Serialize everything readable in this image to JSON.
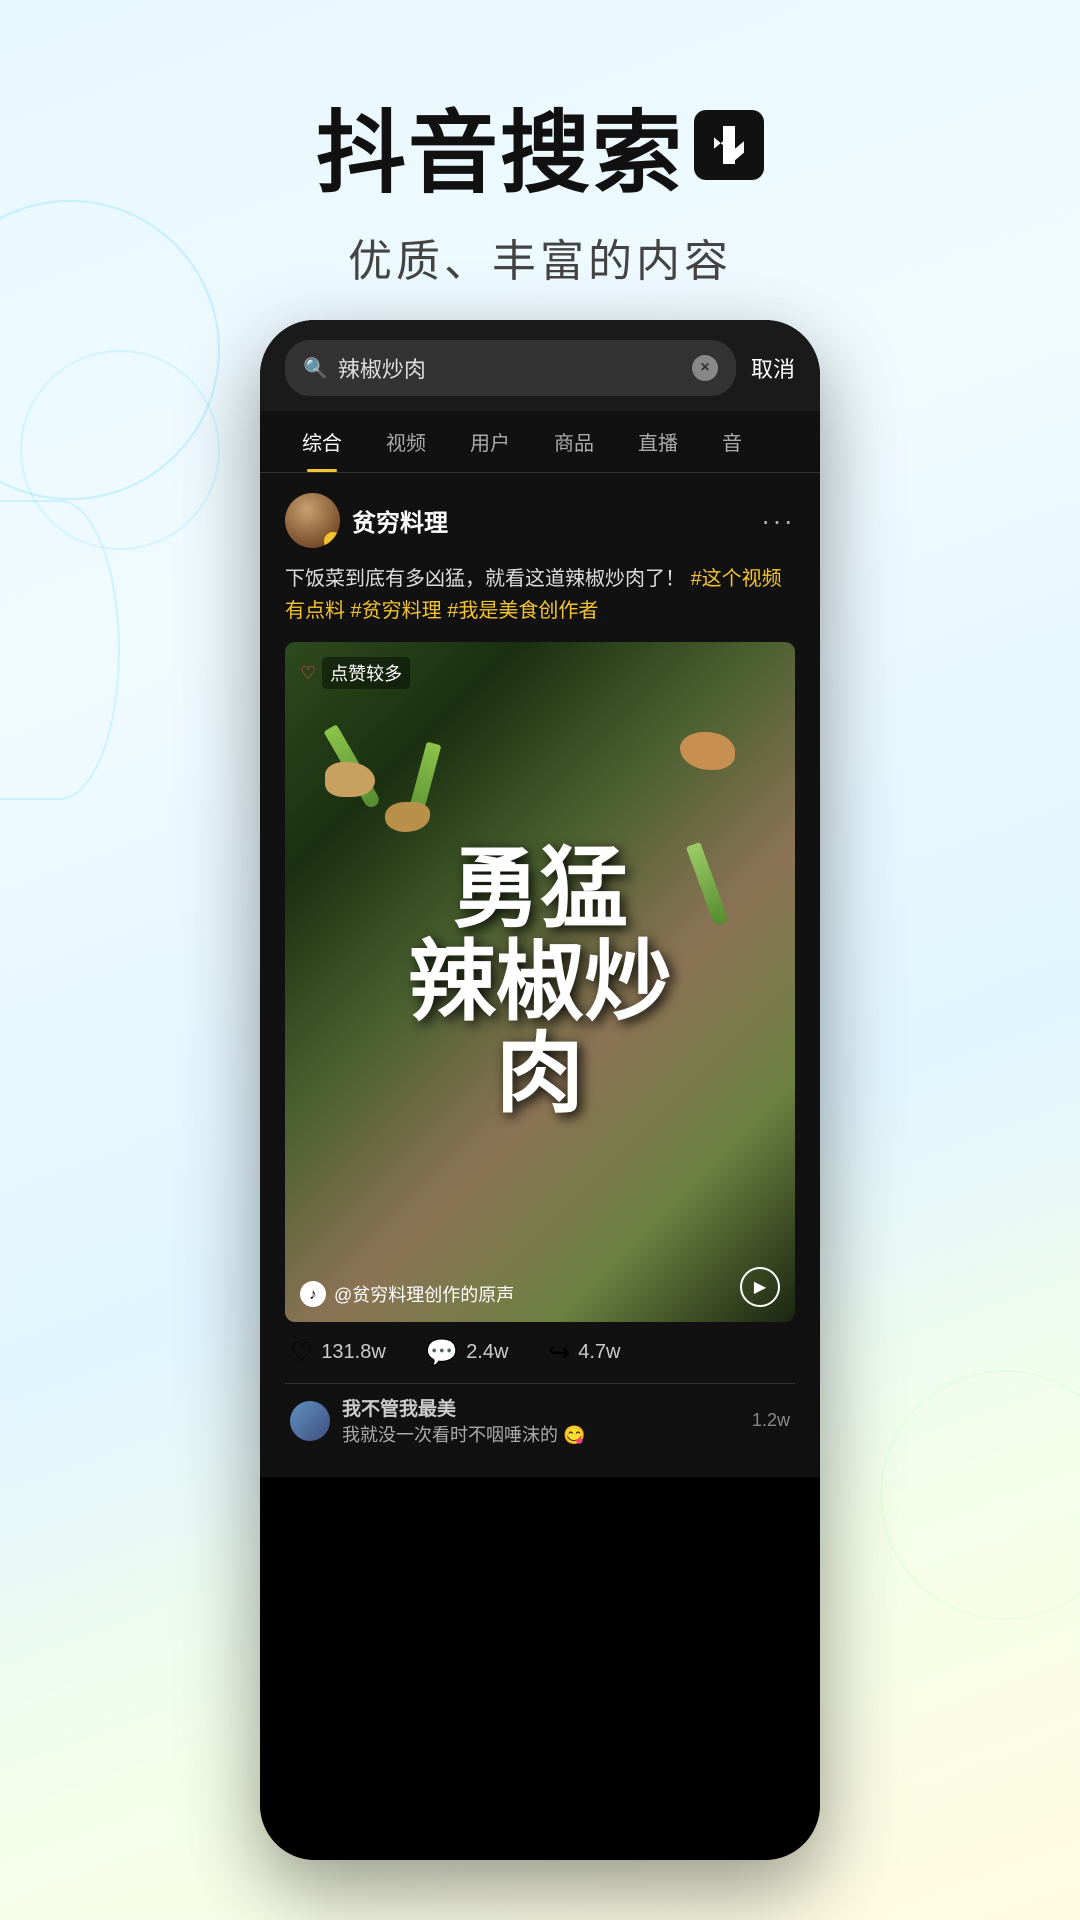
{
  "header": {
    "main_title": "抖音搜索",
    "subtitle": "优质、丰富的内容"
  },
  "search": {
    "query": "辣椒炒肉",
    "cancel_label": "取消",
    "clear_icon": "×"
  },
  "tabs": [
    {
      "label": "综合",
      "active": true
    },
    {
      "label": "视频",
      "active": false
    },
    {
      "label": "用户",
      "active": false
    },
    {
      "label": "商品",
      "active": false
    },
    {
      "label": "直播",
      "active": false
    },
    {
      "label": "音",
      "active": false
    }
  ],
  "post": {
    "username": "贫穷料理",
    "verified": true,
    "more_icon": "···",
    "text": "下饭菜到底有多凶猛，就看这道辣椒炒肉了！",
    "hashtags": "#这个视频有点料 #贫穷料理 #我是美食创作者",
    "video": {
      "badge_text": "点赞较多",
      "big_text": "勇猛辣椒炒肉",
      "audio_text": "@贫穷料理创作的原声"
    },
    "stats": {
      "likes": "131.8w",
      "comments": "2.4w",
      "shares": "4.7w"
    },
    "comment_preview": {
      "username": "我不管我最美",
      "text": "我就没一次看时不咽唾沫的 😋",
      "count": "1.2w"
    }
  }
}
